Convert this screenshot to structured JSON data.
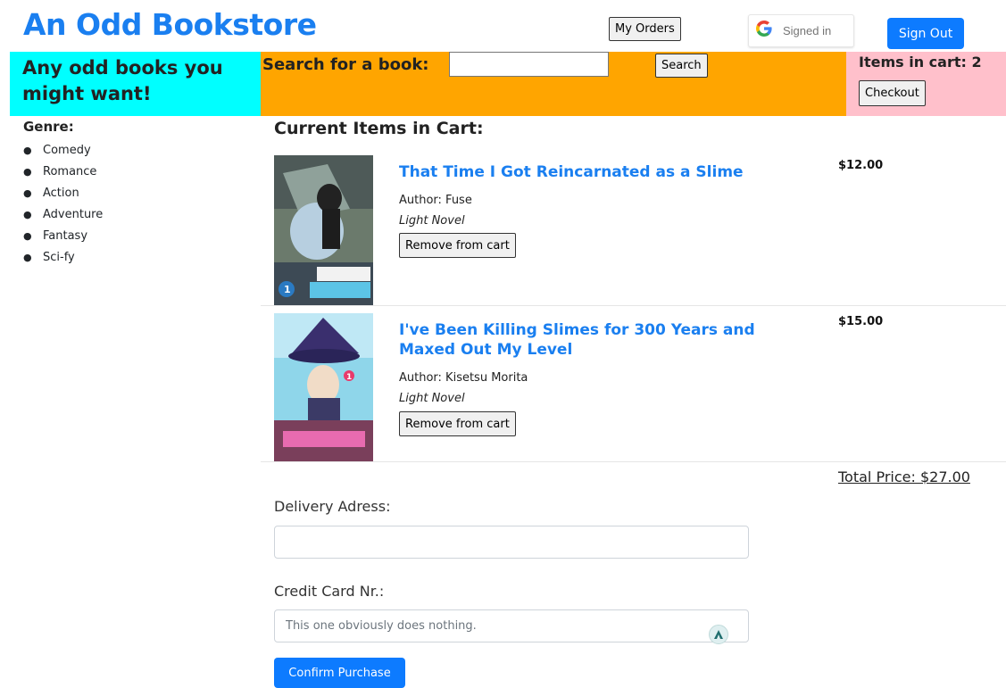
{
  "header": {
    "site_title": "An Odd Bookstore",
    "my_orders_label": "My Orders",
    "google_status": "Signed in",
    "sign_out_label": "Sign Out"
  },
  "banner": {
    "tagline": "Any odd books you might want!",
    "search_label": "Search for a book:",
    "search_value": "",
    "search_button": "Search",
    "cart_count_text": "Items in cart: 2",
    "checkout_label": "Checkout"
  },
  "sidebar": {
    "title": "Genre:",
    "genres": [
      "Comedy",
      "Romance",
      "Action",
      "Adventure",
      "Fantasy",
      "Sci-fy"
    ]
  },
  "cart": {
    "title": "Current Items in Cart:",
    "items": [
      {
        "title": "That Time I Got Reincarnated as a Slime",
        "author": "Author: Fuse",
        "category": "Light Novel",
        "remove_label": "Remove from cart",
        "price": "$12.00"
      },
      {
        "title": "I've Been Killing Slimes for 300 Years and Maxed Out My Level",
        "author": "Author: Kisetsu Morita",
        "category": "Light Novel",
        "remove_label": "Remove from cart",
        "price": "$15.00"
      }
    ],
    "total_text": "Total Price: $27.00"
  },
  "form": {
    "delivery_label": "Delivery Adress:",
    "delivery_value": "",
    "credit_label": "Credit Card Nr.:",
    "credit_placeholder": "This one obviously does nothing.",
    "confirm_label": "Confirm Purchase"
  },
  "colors": {
    "brand_blue": "#1a7ff0",
    "button_blue": "#0d7bff",
    "banner_cyan": "#00ffff",
    "banner_orange": "#ffa500",
    "banner_pink": "#ffc0cb"
  }
}
